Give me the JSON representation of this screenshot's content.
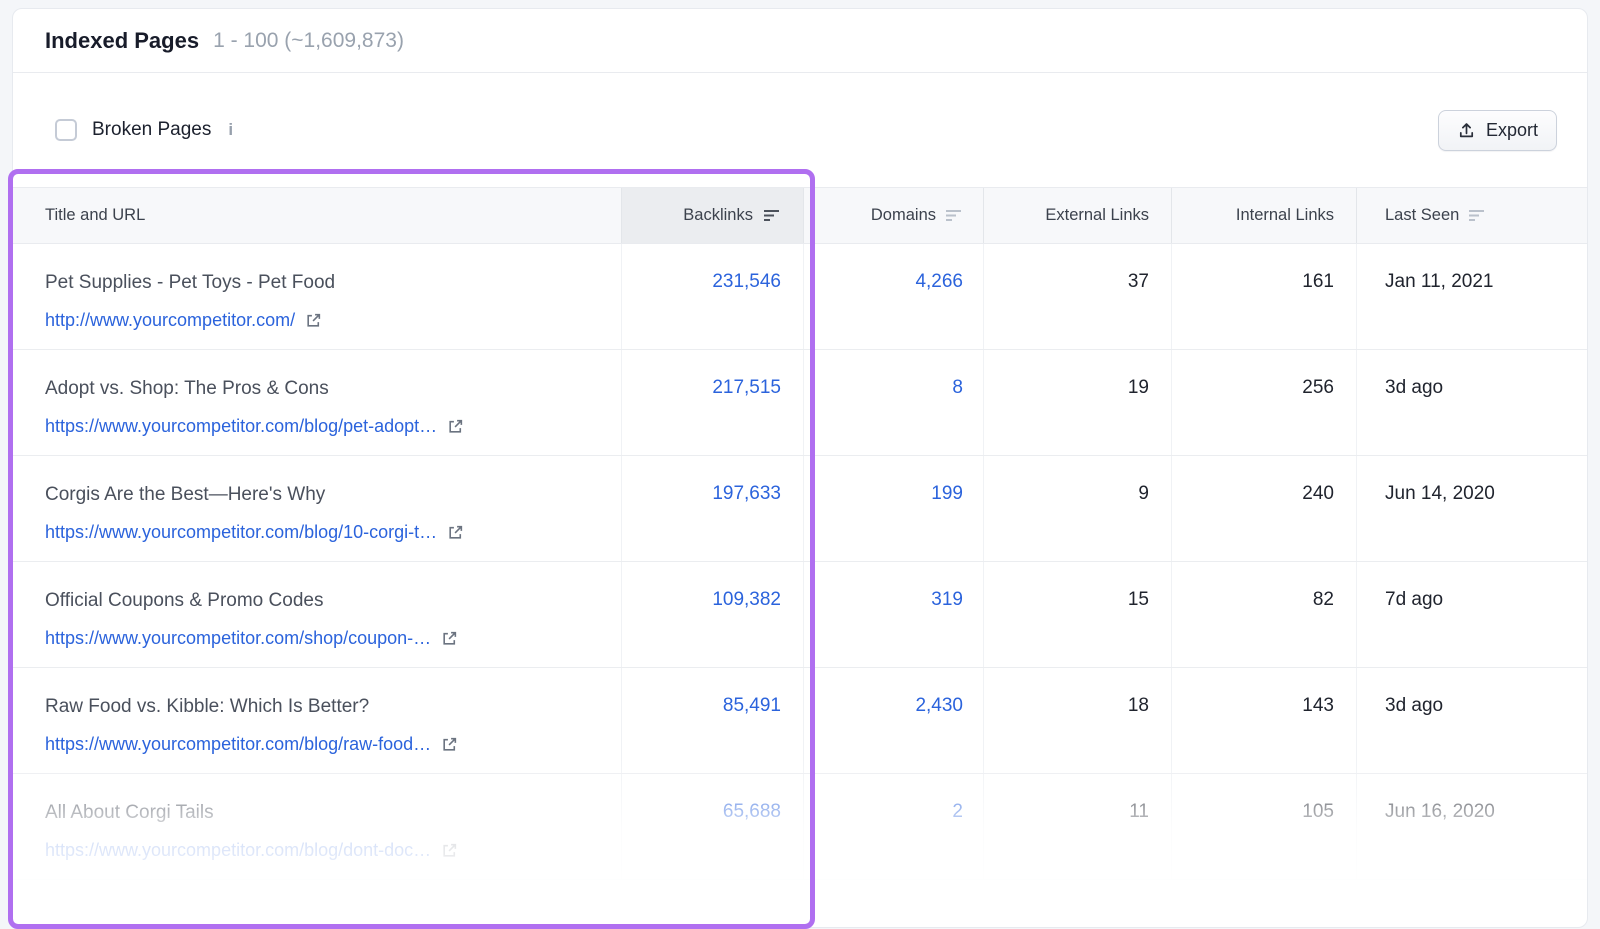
{
  "header": {
    "title": "Indexed Pages",
    "range": "1 - 100 (~1,609,873)"
  },
  "toolbar": {
    "broken_pages_label": "Broken Pages",
    "info_glyph": "i",
    "export_label": "Export"
  },
  "table": {
    "columns": {
      "title": "Title and URL",
      "backlinks": "Backlinks",
      "domains": "Domains",
      "external": "External Links",
      "internal": "Internal Links",
      "last_seen": "Last Seen"
    },
    "rows": [
      {
        "title": "Pet Supplies - Pet Toys - Pet Food",
        "url": "http://www.yourcompetitor.com/",
        "backlinks": "231,546",
        "domains": "4,266",
        "external": "37",
        "internal": "161",
        "last_seen": "Jan 11, 2021"
      },
      {
        "title": "Adopt vs. Shop: The Pros & Cons",
        "url": "https://www.yourcompetitor.com/blog/pet-adopt…",
        "backlinks": "217,515",
        "domains": "8",
        "external": "19",
        "internal": "256",
        "last_seen": "3d ago"
      },
      {
        "title": "Corgis Are the Best—Here's Why",
        "url": "https://www.yourcompetitor.com/blog/10-corgi-t…",
        "backlinks": "197,633",
        "domains": "199",
        "external": "9",
        "internal": "240",
        "last_seen": "Jun 14, 2020"
      },
      {
        "title": "Official Coupons & Promo Codes",
        "url": "https://www.yourcompetitor.com/shop/coupon-…",
        "backlinks": "109,382",
        "domains": "319",
        "external": "15",
        "internal": "82",
        "last_seen": "7d ago"
      },
      {
        "title": "Raw Food vs. Kibble: Which Is Better?",
        "url": "https://www.yourcompetitor.com/blog/raw-food…",
        "backlinks": "85,491",
        "domains": "2,430",
        "external": "18",
        "internal": "143",
        "last_seen": "3d ago"
      },
      {
        "title": "All About Corgi Tails",
        "url": "https://www.yourcompetitor.com/blog/dont-doc…",
        "backlinks": "65,688",
        "domains": "2",
        "external": "11",
        "internal": "105",
        "last_seen": "Jun 16, 2020"
      }
    ]
  },
  "icons": {
    "export": "upload-tray",
    "sort": "descending-bars",
    "external_link": "arrow-out-of-box",
    "info": "letter-i"
  },
  "colors": {
    "accent_blue": "#2b63dc",
    "highlight_purple": "#b06ff0",
    "header_bg": "#f7f8fa",
    "sorted_col_bg": "#ebedf0"
  }
}
